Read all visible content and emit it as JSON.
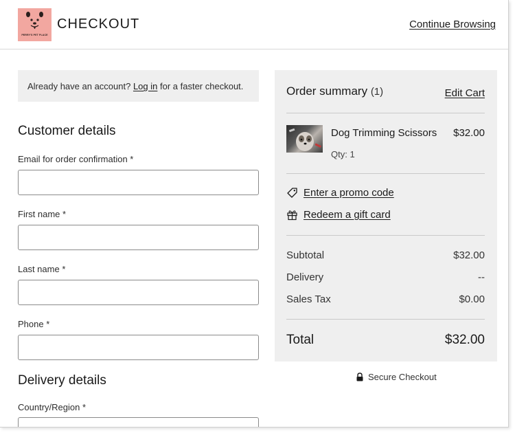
{
  "header": {
    "logo_text": "PERRY'S PET PLACE",
    "title": "CHECKOUT",
    "continue_label": "Continue Browsing"
  },
  "login_banner": {
    "prefix": "Already have an account?",
    "link": "Log in",
    "suffix": "for a faster checkout."
  },
  "customer_details": {
    "title": "Customer details",
    "fields": [
      {
        "label": "Email for order confirmation *",
        "value": ""
      },
      {
        "label": "First name *",
        "value": ""
      },
      {
        "label": "Last name *",
        "value": ""
      },
      {
        "label": "Phone *",
        "value": ""
      }
    ]
  },
  "delivery_details": {
    "title": "Delivery details",
    "fields": [
      {
        "label": "Country/Region *",
        "value": ""
      }
    ]
  },
  "order_summary": {
    "title": "Order summary",
    "count": "(1)",
    "edit_cart": "Edit Cart",
    "item": {
      "name": "Dog Trimming Scissors",
      "price": "$32.00",
      "qty": "Qty: 1"
    },
    "promo_label": "Enter a promo code",
    "gift_label": "Redeem a gift card",
    "subtotal_label": "Subtotal",
    "subtotal_value": "$32.00",
    "delivery_label": "Delivery",
    "delivery_value": "--",
    "tax_label": "Sales Tax",
    "tax_value": "$0.00",
    "total_label": "Total",
    "total_value": "$32.00"
  },
  "secure_label": "Secure Checkout",
  "colors": {
    "logo_bg": "#f2a7a0",
    "panel_bg": "#efefef",
    "text": "#1a1a1a"
  }
}
